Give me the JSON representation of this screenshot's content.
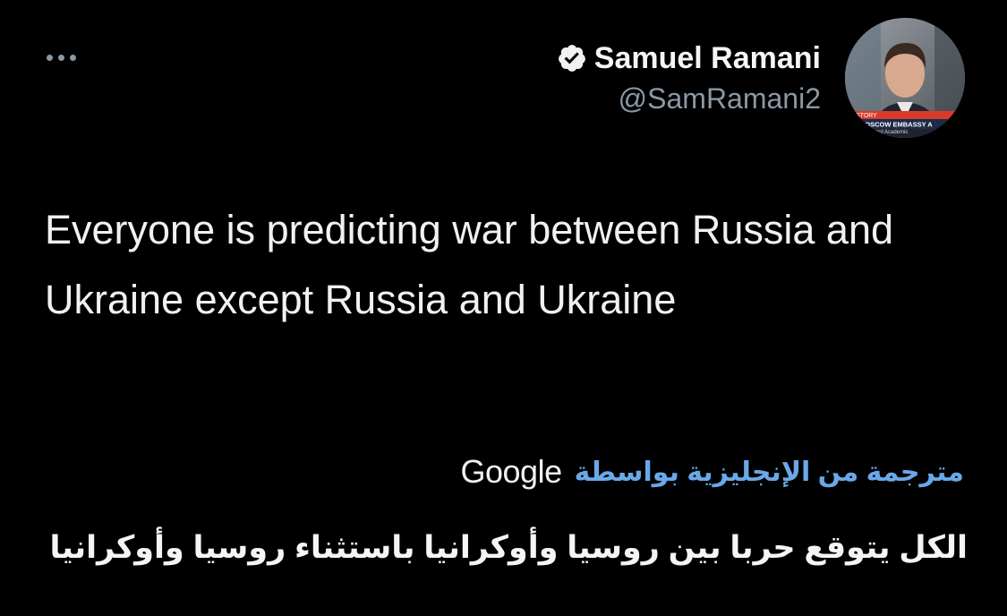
{
  "author": {
    "display_name": "Samuel Ramani",
    "handle": "@SamRamani2",
    "verified": true,
    "avatar_caption_top": "STORY",
    "avatar_caption_main": "MOSCOW EMBASSY A",
    "avatar_caption_sub": "ord Academic"
  },
  "tweet": {
    "text": "Everyone is predicting war between Russia and Ukraine except Russia and Ukraine"
  },
  "translation": {
    "label": "مترجمة من الإنجليزية بواسطة",
    "provider": "Google",
    "text": "الكل يتوقع حربا بين روسيا وأوكرانيا باستثناء روسيا وأوكرانيا"
  },
  "colors": {
    "background": "#000000",
    "text_primary": "#f1f1f1",
    "text_secondary": "#8b98a5",
    "link_blue": "#6aa8e8"
  },
  "icons": {
    "more": "more-horizontal-icon",
    "verified": "verified-badge-icon"
  }
}
